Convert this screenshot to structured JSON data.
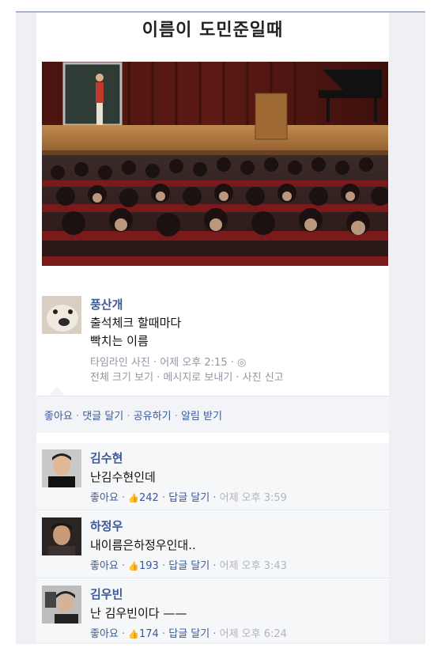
{
  "post": {
    "title": "이름이 도민준일때",
    "author": "풍산개",
    "text_line1": "출석체크 할때마다",
    "text_line2": "빡치는 이름",
    "meta1": "타임라인 사진 · 어제 오후 2:15 · ◎",
    "meta2": "전체 크기 보기 · 메시지로 보내기 · 사진 신고",
    "photo_icon": "lecture-hall-photo",
    "avatar_icon": "dog-avatar"
  },
  "actions": {
    "like": "좋아요",
    "comment": "댓글 달기",
    "share": "공유하기",
    "notify": "알림 받기"
  },
  "comments": [
    {
      "name": "김수현",
      "text": "난김수현인데",
      "like": "좋아요",
      "count": "242",
      "reply": "답글 달기",
      "time": "어제 오후 3:59"
    },
    {
      "name": "하정우",
      "text": "내이름은하정우인대..",
      "like": "좋아요",
      "count": "193",
      "reply": "답글 달기",
      "time": "어제 오후 3:43"
    },
    {
      "name": "김우빈",
      "text": "난 김우빈이다 ——",
      "like": "좋아요",
      "count": "174",
      "reply": "답글 달기",
      "time": "어제 오후 6:24"
    }
  ],
  "colors": {
    "link": "#3b5998",
    "meta": "#9197a3",
    "actionbar": "#f3f4f7"
  }
}
